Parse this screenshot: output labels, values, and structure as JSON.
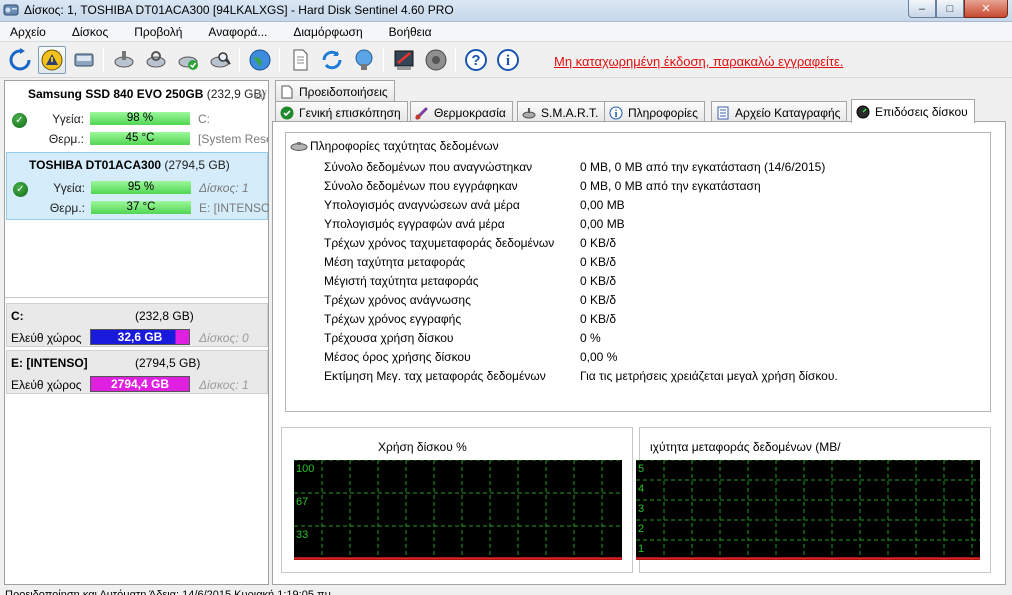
{
  "window": {
    "title": "Δίσκος: 1, TOSHIBA DT01ACA300 [94LKALXGS]  -  Hard Disk Sentinel 4.60 PRO",
    "minimize": "‒",
    "maximize": "□",
    "close": "✕"
  },
  "menu": [
    "Αρχείο",
    "Δίσκος",
    "Προβολή",
    "Αναφορά...",
    "Διαμόρφωση",
    "Βοήθεια"
  ],
  "toolbar": {
    "unregistered_text": "Μη καταχωρημένη έκδοση, παρακαλώ εγγραφείτε."
  },
  "disks": [
    {
      "name": "Samsung SSD 840 EVO 250GB",
      "capacity": "(232,9 GB)",
      "cut_label": "Δί",
      "health_label": "Υγεία:",
      "health": "98 %",
      "health_extra": "C:",
      "temp_label": "Θερμ.:",
      "temp": "45 °C",
      "temp_extra": "[System Rese"
    },
    {
      "name": "TOSHIBA DT01ACA300",
      "capacity": "(2794,5 GB)",
      "health_label": "Υγεία:",
      "health": "95 %",
      "health_extra": "Δίσκος: 1",
      "temp_label": "Θερμ.:",
      "temp": "37 °C",
      "temp_extra": "E: [INTENSO]"
    }
  ],
  "partitions": [
    {
      "name": "C:",
      "capacity": "(232,8 GB)",
      "free_label": "Ελεύθ χώρος",
      "free": "32,6 GB",
      "used_fraction": 0.86,
      "disk": "Δίσκος: 0"
    },
    {
      "name": "E: [INTENSO]",
      "capacity": "(2794,5 GB)",
      "free_label": "Ελεύθ χώρος",
      "free": "2794,4 GB",
      "used_fraction": 0.0,
      "disk": "Δίσκος: 1"
    }
  ],
  "tabs_top": [
    "Προειδοποιήσεις"
  ],
  "tabs": [
    "Γενική επισκόπηση",
    "Θερμοκρασία",
    "S.M.A.R.T.",
    "Πληροφορίες",
    "Αρχείο Καταγραφής",
    "Επιδόσεις δίσκου"
  ],
  "perf": {
    "header": "Πληροφορίες ταχύτητας δεδομένων",
    "rows": [
      {
        "label": "Σύνολο δεδομένων που αναγνώστηκαν",
        "value": "0 MB,  0 MB από την εγκατάσταση  (14/6/2015)"
      },
      {
        "label": "Σύνολο δεδομένων που εγγράφηκαν",
        "value": "0 MB,  0 MB από την εγκατάσταση"
      },
      {
        "label": "Υπολογισμός αναγνώσεων ανά μέρα",
        "value": "0,00 MB"
      },
      {
        "label": "Υπολογισμός εγγραφών ανά μέρα",
        "value": "0,00 MB"
      },
      {
        "label": "Τρέχων χρόνος ταχυμεταφοράς δεδομένων",
        "value": "0 KB/δ"
      },
      {
        "label": "Μέση ταχύτητα μεταφοράς",
        "value": "0 KB/δ"
      },
      {
        "label": "Μέγιστή ταχύτητα μεταφοράς",
        "value": "0 KB/δ"
      },
      {
        "label": "Τρέχων χρόνος ανάγνωσης",
        "value": "0 KB/δ"
      },
      {
        "label": "Τρέχων χρόνος εγγραφής",
        "value": "0 KB/δ"
      },
      {
        "label": "Τρέχουσα χρήση δίσκου",
        "value": "0 %"
      },
      {
        "label": "Μέσος όρος χρήσης δίσκου",
        "value": "0,00 %"
      },
      {
        "label": "Εκτίμηση Μεγ. ταχ μεταφοράς δεδομένων",
        "value": "Για τις μετρήσεις χρειάζεται μεγαλ χρήση δίσκου."
      }
    ]
  },
  "graphs": {
    "usage_title": "Χρήση δίσκου %",
    "usage_ticks": [
      "100",
      "67",
      "33"
    ],
    "speed_title": "ιχύτητα μεταφοράς δεδομένων (MB/",
    "speed_ticks": [
      "5",
      "4",
      "3",
      "2",
      "1"
    ]
  },
  "status": {
    "text": "Προειδοποίηση και Αυτόματη  Άδεια: 14/6/2015 Κυριακή 1:19:05 πμ"
  }
}
